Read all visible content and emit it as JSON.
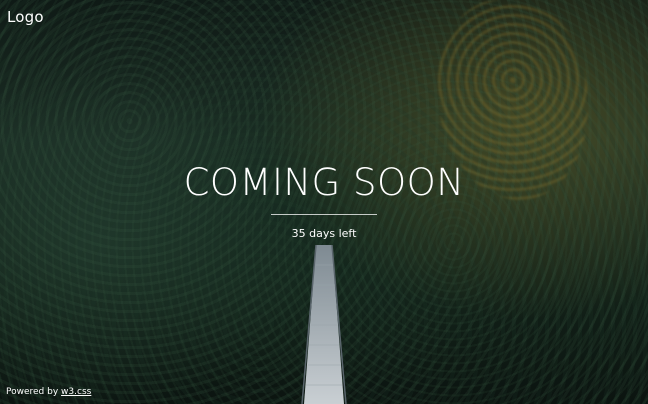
{
  "header": {
    "logo_text": "Logo"
  },
  "main": {
    "headline": "COMING SOON",
    "countdown_text": "35 days left"
  },
  "footer": {
    "powered_by_prefix": "Powered by",
    "link_text": "w3.css"
  },
  "background": {
    "subject": "forest-suspension-bridge-photo",
    "accent_colors": [
      "#1b2d24",
      "#8c7a2e"
    ]
  }
}
